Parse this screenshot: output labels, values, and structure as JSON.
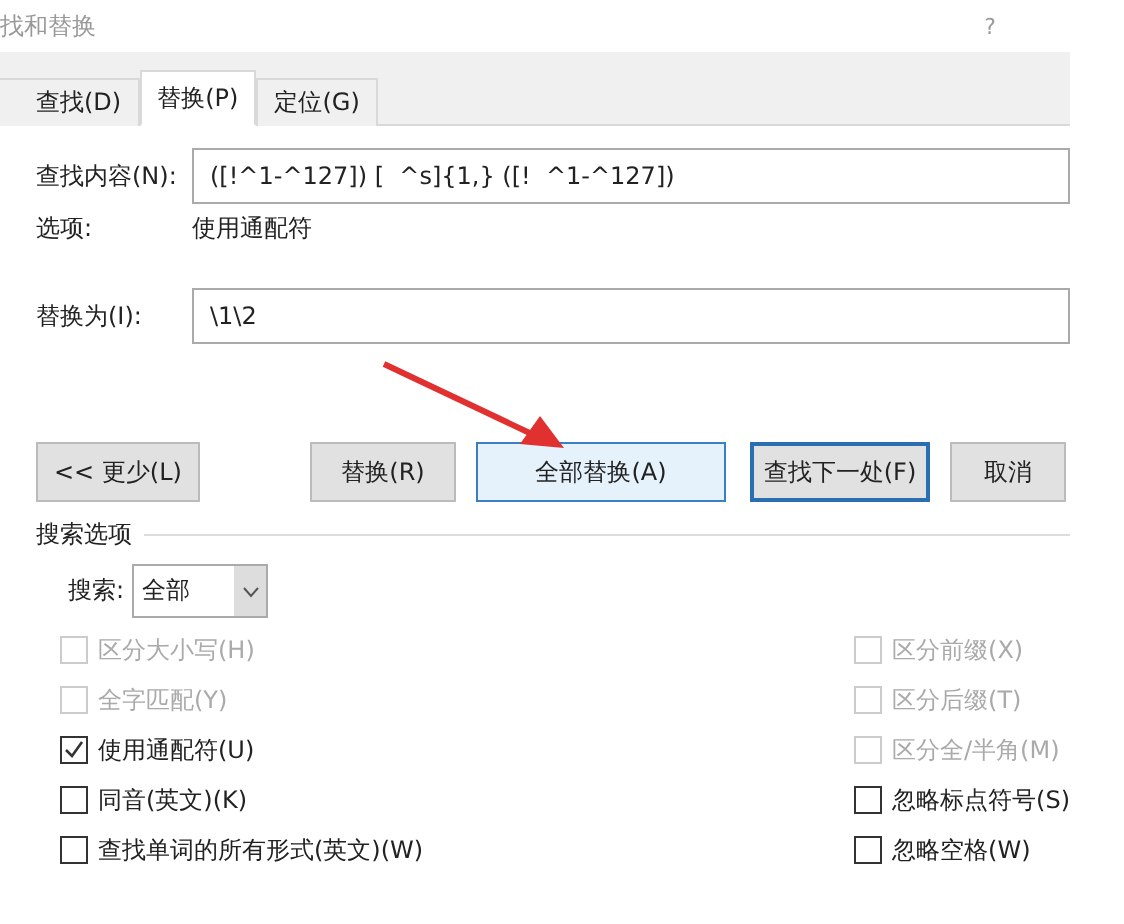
{
  "window": {
    "title": "找和替换",
    "help": "?"
  },
  "tabs": [
    {
      "label": "查找(D)",
      "selected": false
    },
    {
      "label": "替换(P)",
      "selected": true
    },
    {
      "label": "定位(G)",
      "selected": false
    }
  ],
  "find": {
    "label": "查找内容(N):",
    "value": "([!^1-^127]) [  ^s]{1,} ([!  ^1-^127])"
  },
  "options": {
    "label": "选项:",
    "value": "使用通配符"
  },
  "replace": {
    "label": "替换为(I):",
    "value": "\\1\\2"
  },
  "buttons": [
    {
      "label": "<< 更少(L)",
      "kind": "normal"
    },
    {
      "label": "替换(R)",
      "kind": "normal"
    },
    {
      "label": "全部替换(A)",
      "kind": "hover"
    },
    {
      "label": "查找下一处(F)",
      "kind": "default"
    },
    {
      "label": "取消",
      "kind": "normal"
    }
  ],
  "search_options": {
    "title": "搜索选项",
    "search_label": "搜索:",
    "search_value": "全部"
  },
  "left_checks": [
    {
      "label": "区分大小写(H)",
      "checked": false,
      "disabled": true
    },
    {
      "label": "全字匹配(Y)",
      "checked": false,
      "disabled": true
    },
    {
      "label": "使用通配符(U)",
      "checked": true,
      "disabled": false
    },
    {
      "label": "同音(英文)(K)",
      "checked": false,
      "disabled": false
    },
    {
      "label": "查找单词的所有形式(英文)(W)",
      "checked": false,
      "disabled": false
    }
  ],
  "right_checks": [
    {
      "label": "区分前缀(X)",
      "checked": false,
      "disabled": true
    },
    {
      "label": "区分后缀(T)",
      "checked": false,
      "disabled": true
    },
    {
      "label": "区分全/半角(M)",
      "checked": false,
      "disabled": true
    },
    {
      "label": "忽略标点符号(S)",
      "checked": false,
      "disabled": false
    },
    {
      "label": "忽略空格(W)",
      "checked": false,
      "disabled": false
    }
  ]
}
